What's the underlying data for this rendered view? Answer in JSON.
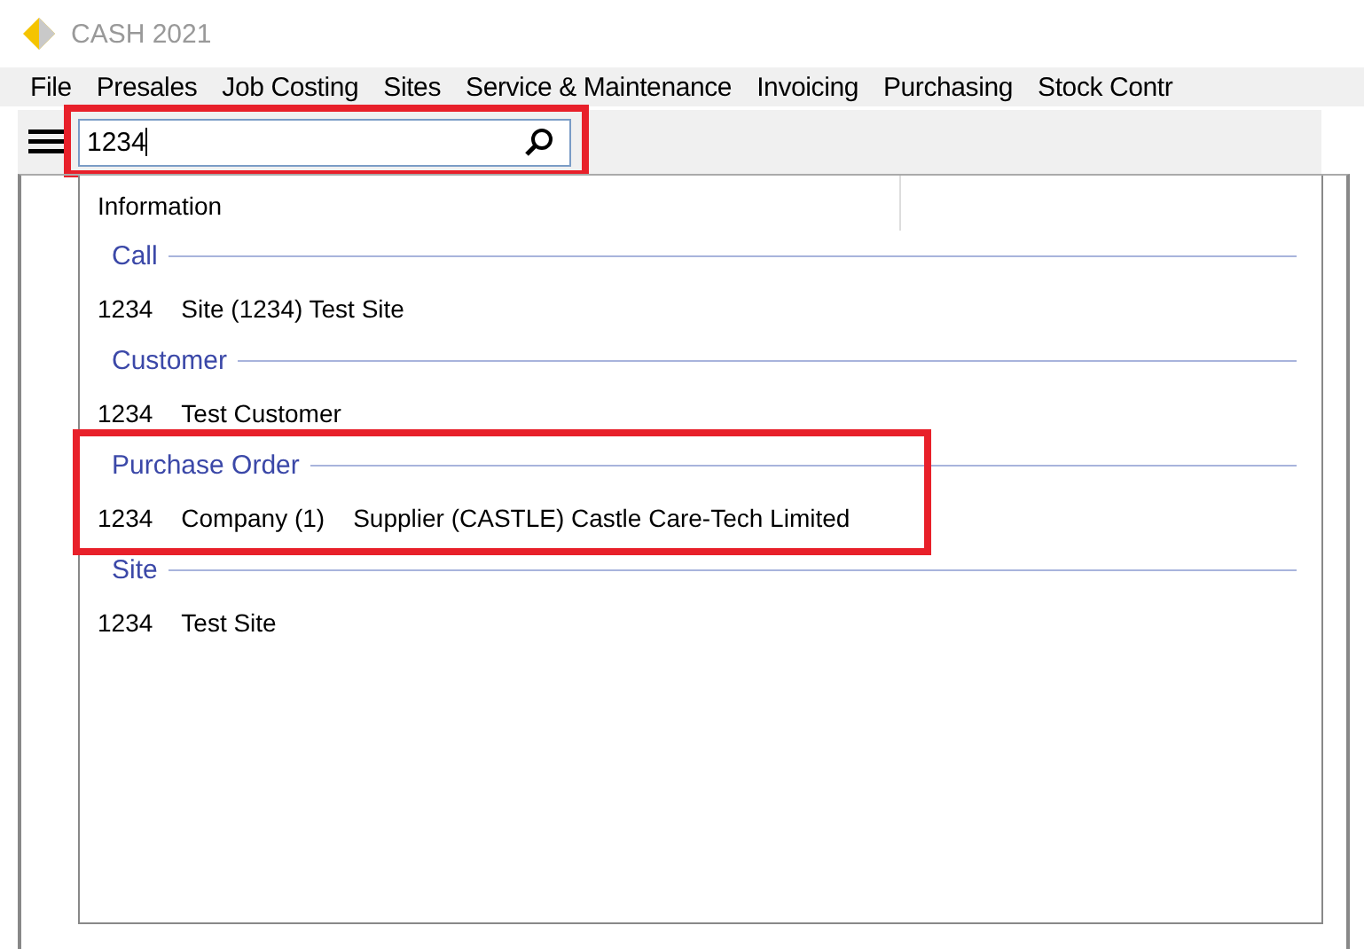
{
  "window": {
    "title": "CASH 2021"
  },
  "menu": [
    "File",
    "Presales",
    "Job Costing",
    "Sites",
    "Service & Maintenance",
    "Invoicing",
    "Purchasing",
    "Stock Contr"
  ],
  "search": {
    "value": "1234",
    "highlighted": true
  },
  "results": {
    "header": "Information",
    "groups": [
      {
        "title": "Call",
        "highlighted": false,
        "items": [
          {
            "cells": [
              "1234",
              "Site (1234) Test Site"
            ]
          }
        ]
      },
      {
        "title": "Customer",
        "highlighted": false,
        "items": [
          {
            "cells": [
              "1234",
              "Test Customer"
            ]
          }
        ]
      },
      {
        "title": "Purchase Order",
        "highlighted": true,
        "items": [
          {
            "cells": [
              "1234",
              "Company (1)",
              "Supplier (CASTLE) Castle Care-Tech Limited"
            ]
          }
        ]
      },
      {
        "title": "Site",
        "highlighted": false,
        "items": [
          {
            "cells": [
              "1234",
              "Test Site"
            ]
          }
        ]
      }
    ]
  }
}
